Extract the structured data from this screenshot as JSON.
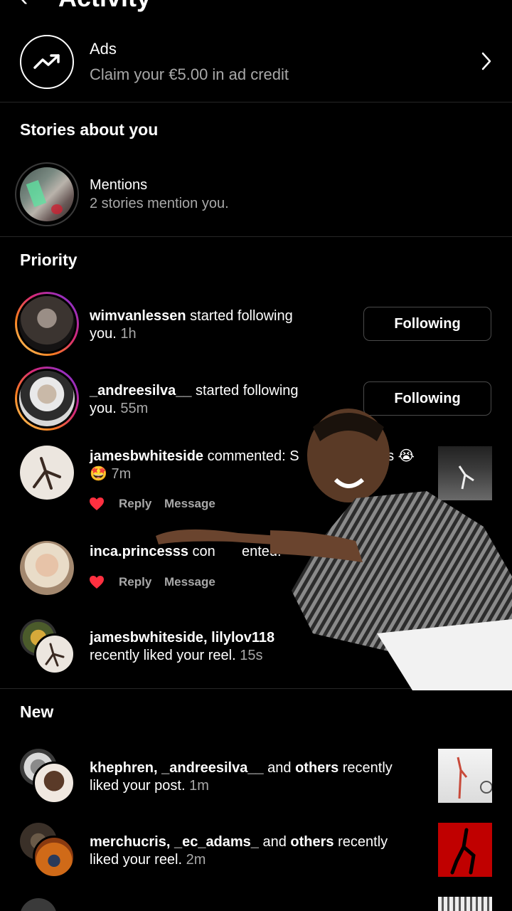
{
  "header": {
    "title": "Activity"
  },
  "ads": {
    "title": "Ads",
    "subtitle": "Claim your €5.00 in ad credit"
  },
  "stories": {
    "heading": "Stories about you",
    "mentions_title": "Mentions",
    "mentions_sub": "2 stories mention you."
  },
  "priority": {
    "heading": "Priority",
    "items": [
      {
        "user": "wimvanlessen",
        "action": " started following",
        "line2": "you.",
        "time": "1h",
        "button": "Following"
      },
      {
        "user": "_andreesilva__",
        "action": " started following",
        "line2": "you.",
        "time": "55m",
        "button": "Following"
      },
      {
        "user": "jamesbwhiteside",
        "action": " commented: S",
        "tail": "us 😭",
        "line2": "🤩",
        "time": "7m",
        "reply": "Reply",
        "message": "Message"
      },
      {
        "user": "inca.princesss",
        "action": " con",
        "tail": "ented:",
        "reply": "Reply",
        "message": "Message"
      },
      {
        "user": "jamesbwhiteside, lilylov118",
        "line2": "recently liked your reel.",
        "time": "15s"
      }
    ]
  },
  "new": {
    "heading": "New",
    "items": [
      {
        "users": "khephren, _andreesilva__",
        "and": " and ",
        "others": "others",
        "action": " recently",
        "line2": "liked your post.",
        "time": "1m"
      },
      {
        "users": "merchucris, _ec_adams_",
        "and": " and ",
        "others": "others",
        "action": " recently",
        "line2": "liked your reel.",
        "time": "2m"
      }
    ]
  },
  "colors": {
    "heart": "#ff3040",
    "muted": "#a8a8a8",
    "divider": "#262626"
  }
}
